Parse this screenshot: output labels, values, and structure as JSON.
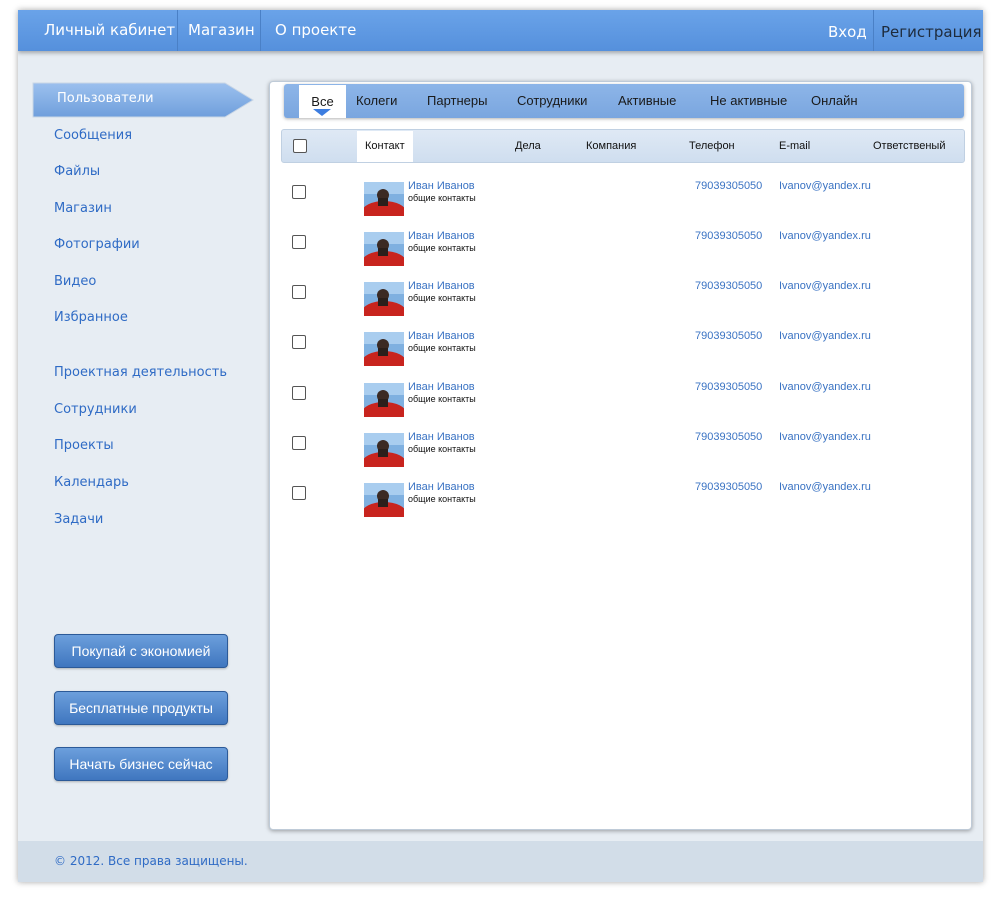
{
  "topnav": {
    "items": [
      {
        "label": "Личный кабинет"
      },
      {
        "label": "Магазин"
      },
      {
        "label": "О проекте"
      }
    ],
    "login": "Вход",
    "register": "Регистрация"
  },
  "sidebar": {
    "active": "Пользователи",
    "items": [
      {
        "label": "Сообщения"
      },
      {
        "label": "Файлы"
      },
      {
        "label": "Магазин"
      },
      {
        "label": "Фотографии"
      },
      {
        "label": "Видео"
      },
      {
        "label": "Избранное"
      },
      {
        "label": "Проектная деятельность"
      },
      {
        "label": "Сотрудники"
      },
      {
        "label": "Проекты"
      },
      {
        "label": "Календарь"
      },
      {
        "label": "Задачи"
      }
    ],
    "buttons": [
      {
        "label": "Покупай с экономией"
      },
      {
        "label": "Бесплатные продукты"
      },
      {
        "label": "Начать бизнес сейчас"
      }
    ]
  },
  "tabs": [
    {
      "label": "Все",
      "active": true
    },
    {
      "label": "Колеги"
    },
    {
      "label": "Партнеры"
    },
    {
      "label": "Сотрудники"
    },
    {
      "label": "Активные"
    },
    {
      "label": "Не активные"
    },
    {
      "label": "Онлайн"
    }
  ],
  "columns": [
    "Контакт",
    "Дела",
    "Компания",
    "Телефон",
    "E-mail",
    "Ответственый"
  ],
  "rows": [
    {
      "name": "Иван  Иванов",
      "group": "общие контакты",
      "phone": "79039305050",
      "email": "Ivanov@yandex.ru"
    },
    {
      "name": "Иван  Иванов",
      "group": "общие контакты",
      "phone": "79039305050",
      "email": "Ivanov@yandex.ru"
    },
    {
      "name": "Иван  Иванов",
      "group": "общие контакты",
      "phone": "79039305050",
      "email": "Ivanov@yandex.ru"
    },
    {
      "name": "Иван  Иванов",
      "group": "общие контакты",
      "phone": "79039305050",
      "email": "Ivanov@yandex.ru"
    },
    {
      "name": "Иван  Иванов",
      "group": "общие контакты",
      "phone": "79039305050",
      "email": "Ivanov@yandex.ru"
    },
    {
      "name": "Иван  Иванов",
      "group": "общие контакты",
      "phone": "79039305050",
      "email": "Ivanov@yandex.ru"
    },
    {
      "name": "Иван  Иванов",
      "group": "общие контакты",
      "phone": "79039305050",
      "email": "Ivanov@yandex.ru"
    }
  ],
  "footer": {
    "copyright": "© 2012. Все права защищены."
  },
  "colors": {
    "accent": "#5c98e2",
    "link": "#2f6bc5",
    "background": "#e7edf3"
  }
}
